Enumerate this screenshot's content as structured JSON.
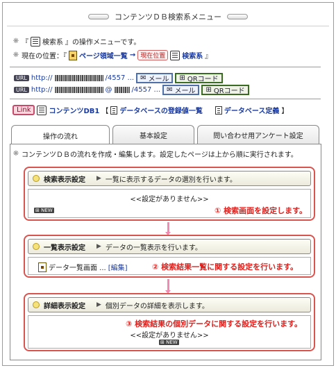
{
  "window": {
    "title": "コンテンツＤＢ検索系メニュー"
  },
  "intro": {
    "line1_prefix": "『",
    "line1_name": "検索系",
    "line1_suffix": "』の操作メニューです。",
    "location_label": "現在の位置：『",
    "location_page": "ページ領域一覧",
    "location_arrow": "→",
    "location_here": "現在位置",
    "location_current": "検索系",
    "location_end": "』"
  },
  "urls": [
    {
      "badge": "URL",
      "prefix": "http://",
      "suffix": "/4557 ...",
      "mail": "メール",
      "qr": "QRコード"
    },
    {
      "badge": "URL",
      "prefix": "http://",
      "suffix": "/4557 ...",
      "mail": "メール",
      "qr": "QRコード"
    }
  ],
  "links": {
    "badge": "Link",
    "db_name": "コンテンツDB1",
    "bracket_open": "【",
    "registered_list": "データベースの登録値一覧",
    "definition": "データベース定義",
    "bracket_close": "】"
  },
  "tabs": [
    {
      "label": "操作の流れ",
      "active": true
    },
    {
      "label": "基本設定",
      "active": false
    },
    {
      "label": "問い合わせ用アンケート設定",
      "active": false
    }
  ],
  "flow_description": "コンテンツＤＢの流れを作成・編集します。設定したページは上から順に実行されます。",
  "steps": [
    {
      "name": "検索表示設定",
      "desc": "一覧に表示するデータの選別を行います。",
      "body_text": "<<設定がありません>>",
      "new_label": "NEW",
      "note": "① 検索画面を設定します。"
    },
    {
      "name": "一覧表示設定",
      "desc": "データの一覧表示を行います。",
      "page_name": "データ一覧画面 ...",
      "edit_label": "[編集]",
      "note": "② 検索結果一覧に関する設定を行います。"
    },
    {
      "name": "詳細表示設定",
      "desc": "個別データの詳細を表示します。",
      "body_text": "<<設定がありません>>",
      "new_label": "NEW",
      "note": "③ 検索結果の個別データに関する設定を行います。"
    }
  ],
  "colors": {
    "accent_red": "#e0201c",
    "link_blue": "#1a3a9e",
    "connector_pink": "#f08ab0"
  }
}
